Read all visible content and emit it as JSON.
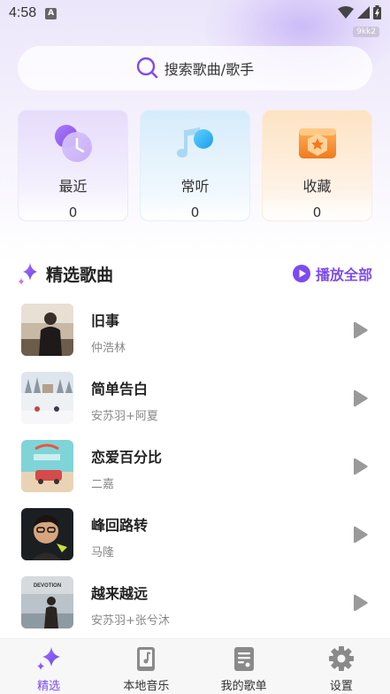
{
  "status_bar": {
    "time": "4:58",
    "notification_badge": "A",
    "watermark": "9kk2"
  },
  "search": {
    "placeholder": "搜索歌曲/歌手"
  },
  "cards": [
    {
      "title": "最近",
      "count": "0",
      "icon": "clock-icon"
    },
    {
      "title": "常听",
      "count": "0",
      "icon": "music-note-icon"
    },
    {
      "title": "收藏",
      "count": "0",
      "icon": "star-box-icon"
    }
  ],
  "section": {
    "title": "精选歌曲",
    "play_all": "播放全部"
  },
  "songs": [
    {
      "title": "旧事",
      "artist": "仲浩林"
    },
    {
      "title": "简单告白",
      "artist": "安苏羽+阿夏"
    },
    {
      "title": "恋爱百分比",
      "artist": "二嘉"
    },
    {
      "title": "峰回路转",
      "artist": "马隆"
    },
    {
      "title": "越来越远",
      "artist": "安苏羽+张兮沐",
      "cover_text": "DEVOTION"
    }
  ],
  "tabs": [
    {
      "label": "精选",
      "active": true,
      "icon": "sparkle-icon"
    },
    {
      "label": "本地音乐",
      "active": false,
      "icon": "phone-music-icon"
    },
    {
      "label": "我的歌单",
      "active": false,
      "icon": "playlist-doc-icon"
    },
    {
      "label": "设置",
      "active": false,
      "icon": "gear-icon"
    }
  ],
  "colors": {
    "accent": "#7d4bf0",
    "text": "#222222",
    "secondary_text": "#888888"
  }
}
